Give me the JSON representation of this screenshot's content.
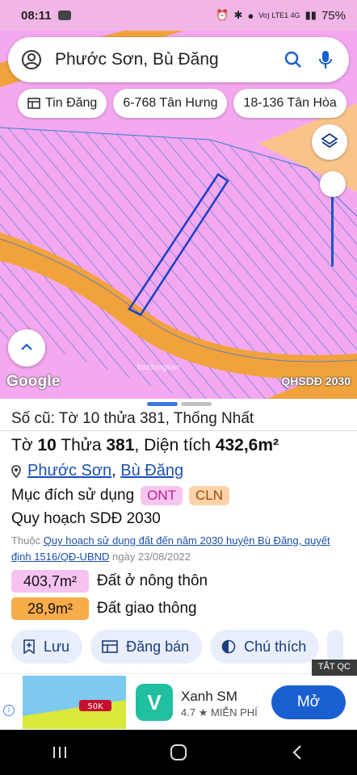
{
  "status_bar": {
    "time": "08:11",
    "indicators": "Vo) LTE1 4G",
    "battery": "75%"
  },
  "search": {
    "query": "Phước Sơn, Bù Đăng"
  },
  "chips": [
    {
      "label": "Tin Đăng",
      "icon": "listing-icon"
    },
    {
      "label": "6-768 Tân Hưng"
    },
    {
      "label": "18-136 Tân Hòa"
    }
  ],
  "map": {
    "google_label": "Google",
    "overlay_label": "QHSDĐ 2030",
    "watermark": "batdongsan"
  },
  "parcel": {
    "old_info": "Số cũ: Tờ 10 thửa 381, Thống Nhất",
    "sheet_label": "Tờ",
    "sheet": "10",
    "lot_label": "Thửa",
    "lot": "381",
    "area_label": "Diện tích",
    "area": "432,6m²",
    "commune": "Phước Sơn",
    "district": "Bù Đăng",
    "purpose_label": "Mục đích sử dụng",
    "purpose_tags": [
      "ONT",
      "CLN"
    ],
    "plan_label": "Quy hoạch SDĐ 2030",
    "note_prefix": "Thuộc",
    "note_link": "Quy hoạch sử dụng đất đến năm 2030 huyện Bù Đăng, quyết định 1516/QĐ-UBND",
    "note_date": "ngày 23/08/2022",
    "areas": [
      {
        "value": "403,7m²",
        "label": "Đất ở nông thôn",
        "color": "#f6c2f0"
      },
      {
        "value": "28,9m²",
        "label": "Đất giao thông",
        "color": "#f8ac4a"
      }
    ]
  },
  "actions": [
    {
      "label": "Lưu"
    },
    {
      "label": "Đăng bán"
    },
    {
      "label": "Chú thích"
    }
  ],
  "ad": {
    "close_label": "TẮT QC",
    "app_name": "Xanh SM",
    "rating": "4.7",
    "price": "MIỄN PHÍ",
    "open_label": "Mở",
    "banner_text": "50K"
  },
  "colors": {
    "accent": "#1a5fd0",
    "map_pink": "#f4a8ef",
    "road_orange": "#f2a23c",
    "hatch_blue": "#3a7bd5"
  }
}
